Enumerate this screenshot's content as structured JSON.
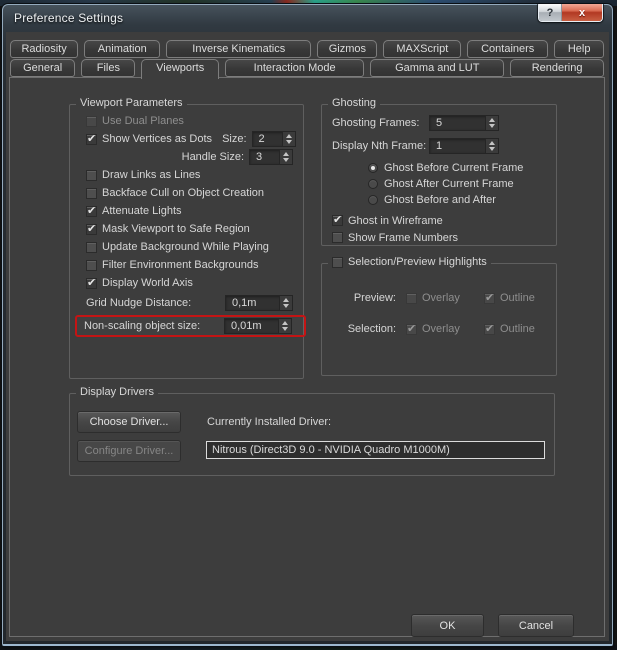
{
  "window": {
    "title": "Preference Settings",
    "help_glyph": "?",
    "close_glyph": "x"
  },
  "tabs": {
    "row1": [
      {
        "label": "Radiosity"
      },
      {
        "label": "Animation"
      },
      {
        "label": "Inverse Kinematics"
      },
      {
        "label": "Gizmos"
      },
      {
        "label": "MAXScript"
      },
      {
        "label": "Containers"
      },
      {
        "label": "Help"
      }
    ],
    "row2": [
      {
        "label": "General"
      },
      {
        "label": "Files"
      },
      {
        "label": "Viewports",
        "active": true
      },
      {
        "label": "Interaction Mode"
      },
      {
        "label": "Gamma and LUT"
      },
      {
        "label": "Rendering"
      }
    ]
  },
  "viewport_params": {
    "title": "Viewport Parameters",
    "use_dual_planes": {
      "label": "Use Dual Planes",
      "checked": false,
      "disabled": true
    },
    "show_vertices": {
      "label": "Show Vertices as Dots",
      "checked": true
    },
    "size": {
      "label": "Size:",
      "value": "2"
    },
    "handle_size": {
      "label": "Handle Size:",
      "value": "3"
    },
    "draw_links": {
      "label": "Draw Links as Lines",
      "checked": false
    },
    "backface_cull": {
      "label": "Backface Cull on Object Creation",
      "checked": false
    },
    "attenuate_lights": {
      "label": "Attenuate Lights",
      "checked": true
    },
    "mask_viewport": {
      "label": "Mask Viewport to Safe Region",
      "checked": true
    },
    "update_background": {
      "label": "Update Background While Playing",
      "checked": false
    },
    "filter_env": {
      "label": "Filter Environment Backgrounds",
      "checked": false
    },
    "display_world_axis": {
      "label": "Display World Axis",
      "checked": true
    },
    "grid_nudge": {
      "label": "Grid Nudge Distance:",
      "value": "0,1m"
    },
    "non_scaling": {
      "label": "Non-scaling object size:",
      "value": "0,01m",
      "highlighted": true
    }
  },
  "ghosting": {
    "title": "Ghosting",
    "frames": {
      "label": "Ghosting Frames:",
      "value": "5"
    },
    "nth_frame": {
      "label": "Display Nth Frame:",
      "value": "1"
    },
    "radios": [
      {
        "label": "Ghost Before Current Frame",
        "selected": true
      },
      {
        "label": "Ghost After Current Frame",
        "selected": false
      },
      {
        "label": "Ghost Before and After",
        "selected": false
      }
    ],
    "ghost_wireframe": {
      "label": "Ghost in Wireframe",
      "checked": true
    },
    "show_frame_numbers": {
      "label": "Show Frame Numbers",
      "checked": false
    }
  },
  "selection_preview": {
    "title": "Selection/Preview Highlights",
    "enabled": false,
    "preview_label": "Preview:",
    "selection_label": "Selection:",
    "preview": {
      "overlay": {
        "label": "Overlay",
        "checked": false,
        "disabled": true
      },
      "outline": {
        "label": "Outline",
        "checked": true,
        "disabled": true
      }
    },
    "selection": {
      "overlay": {
        "label": "Overlay",
        "checked": true,
        "disabled": true
      },
      "outline": {
        "label": "Outline",
        "checked": true,
        "disabled": true
      }
    }
  },
  "display_drivers": {
    "title": "Display Drivers",
    "choose_button": "Choose Driver...",
    "configure_button": "Configure Driver...",
    "configure_disabled": true,
    "current_label": "Currently Installed Driver:",
    "driver": "Nitrous (Direct3D 9.0 - NVIDIA Quadro M1000M)"
  },
  "footer": {
    "ok": "OK",
    "cancel": "Cancel"
  },
  "colors": {
    "highlight_red": "#c41414",
    "close_red": "#c0392b",
    "dialog_bg": "#3d3d3d"
  }
}
